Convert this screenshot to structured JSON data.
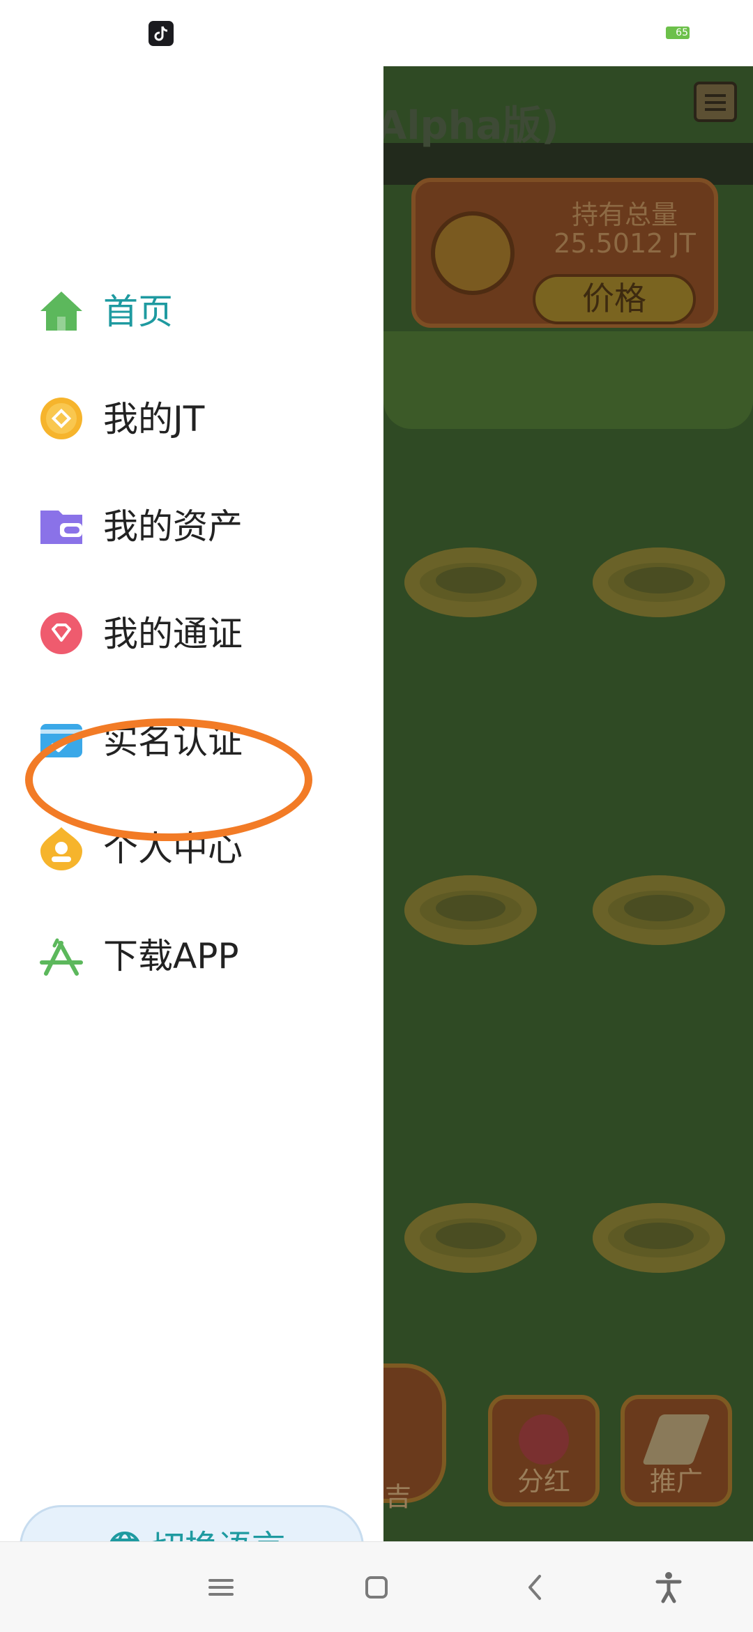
{
  "status_bar": {
    "app_icon": "tiktok-icon",
    "battery_level": "65",
    "battery_color": "#6cc04a"
  },
  "game": {
    "title_fragment": "Alpha版)",
    "holding_label": "持有总量",
    "holding_value": "25.5012 JT",
    "price_label": "价格",
    "bottom_buttons": [
      "吉",
      "分红",
      "推广"
    ]
  },
  "drawer": {
    "menu_items": [
      {
        "label": "首页",
        "icon": "home-icon",
        "active": true,
        "color": "#5cb85c"
      },
      {
        "label": "我的JT",
        "icon": "coin-icon",
        "active": false,
        "color": "#f6b42c"
      },
      {
        "label": "我的资产",
        "icon": "wallet-icon",
        "active": false,
        "color": "#8a72e8"
      },
      {
        "label": "我的通证",
        "icon": "diamond-icon",
        "active": false,
        "color": "#ef5b6e"
      },
      {
        "label": "实名认证",
        "icon": "id-card-icon",
        "active": false,
        "color": "#3aa8e8"
      },
      {
        "label": "个人中心",
        "icon": "user-icon",
        "active": false,
        "color": "#f6b42c"
      },
      {
        "label": "下载APP",
        "icon": "app-store-icon",
        "active": false,
        "color": "#5cb85c"
      }
    ],
    "language_button": {
      "label": "切换语言",
      "icon": "globe-icon"
    },
    "accent_color": "#1e9aa0",
    "highlight_color": "#f27b26"
  },
  "nav_bar": {
    "buttons": [
      "menu-icon",
      "home-square-icon",
      "back-icon",
      "accessibility-icon"
    ]
  }
}
